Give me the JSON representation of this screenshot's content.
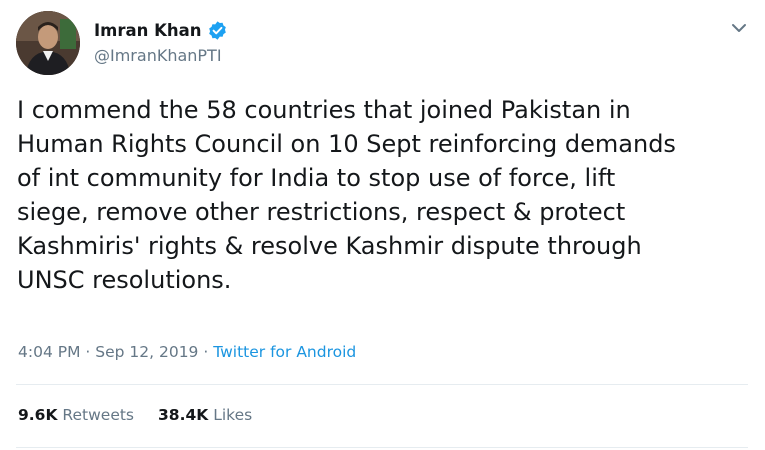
{
  "author": {
    "display_name": "Imran Khan",
    "handle": "@ImranKhanPTI",
    "verified": true
  },
  "tweet": {
    "lines": [
      "I commend the 58 countries that joined Pakistan in",
      "Human Rights Council on 10 Sept reinforcing demands",
      "of int community for India to stop use of force, lift",
      "siege, remove other restrictions, respect & protect",
      "Kashmiris' rights & resolve Kashmir dispute through",
      "UNSC resolutions."
    ]
  },
  "meta": {
    "time": "4:04 PM",
    "separator": " · ",
    "date": "Sep 12, 2019",
    "source": "Twitter for Android"
  },
  "stats": {
    "retweets_count": "9.6K",
    "retweets_label": "Retweets",
    "likes_count": "38.4K",
    "likes_label": "Likes"
  },
  "colors": {
    "verified_badge": "#1da1f2",
    "link": "#1b95e0",
    "secondary_text": "#657786",
    "divider": "#e6ecf0"
  },
  "icons": {
    "verified": "verified-badge-icon",
    "more": "chevron-down-icon"
  }
}
